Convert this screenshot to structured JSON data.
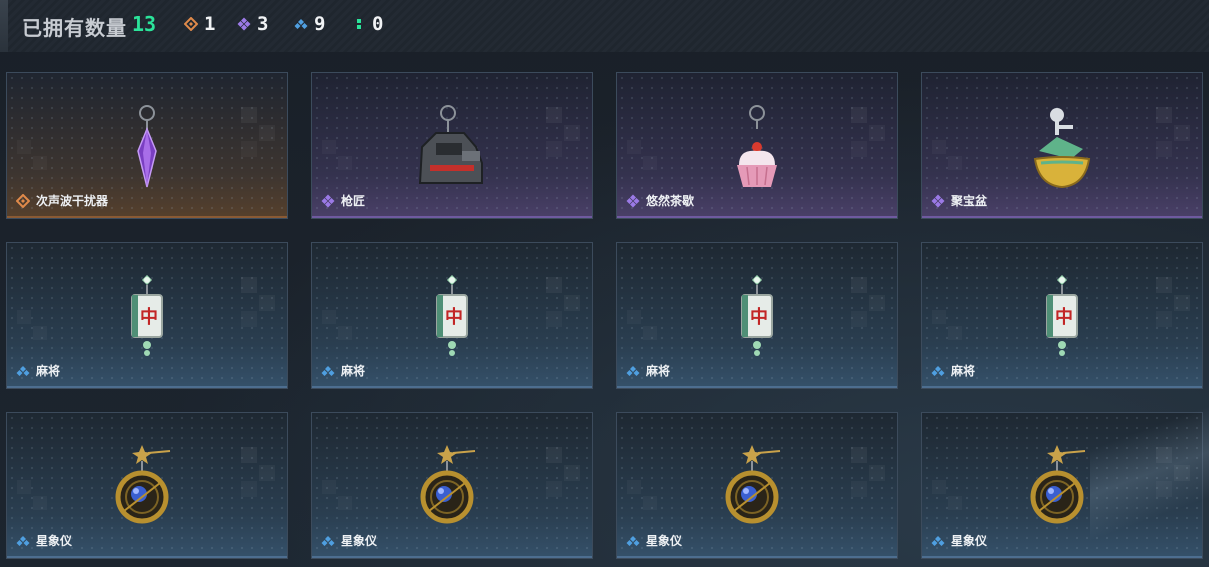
{
  "header": {
    "title": "已拥有数量",
    "total": "13",
    "rarities": [
      {
        "tier": "orange",
        "color": "#e08a4a",
        "count": "1",
        "icon": "diamond-orange-icon"
      },
      {
        "tier": "purple",
        "color": "#9b7ae6",
        "count": "3",
        "icon": "diamond-purple-icon"
      },
      {
        "tier": "blue",
        "color": "#4f9fe0",
        "count": "9",
        "icon": "diamond-blue-icon"
      },
      {
        "tier": "green",
        "color": "#2be39a",
        "count": "0",
        "icon": "dots-green-icon"
      }
    ]
  },
  "items": [
    {
      "name": "次声波干扰器",
      "tier": "orange",
      "icon": "purple-crystal-charm-icon"
    },
    {
      "name": "枪匠",
      "tier": "purple",
      "icon": "gun-part-charm-icon"
    },
    {
      "name": "悠然茶歇",
      "tier": "purple",
      "icon": "cupcake-charm-icon"
    },
    {
      "name": "聚宝盆",
      "tier": "purple",
      "icon": "treasure-bowl-charm-icon"
    },
    {
      "name": "麻将",
      "tier": "blue",
      "icon": "mahjong-tile-charm-icon"
    },
    {
      "name": "麻将",
      "tier": "blue",
      "icon": "mahjong-tile-charm-icon"
    },
    {
      "name": "麻将",
      "tier": "blue",
      "icon": "mahjong-tile-charm-icon"
    },
    {
      "name": "麻将",
      "tier": "blue",
      "icon": "mahjong-tile-charm-icon"
    },
    {
      "name": "星象仪",
      "tier": "blue",
      "icon": "astrolabe-charm-icon"
    },
    {
      "name": "星象仪",
      "tier": "blue",
      "icon": "astrolabe-charm-icon"
    },
    {
      "name": "星象仪",
      "tier": "blue",
      "icon": "astrolabe-charm-icon"
    },
    {
      "name": "星象仪",
      "tier": "blue",
      "icon": "astrolabe-charm-icon"
    }
  ],
  "mahjong_character": "中"
}
